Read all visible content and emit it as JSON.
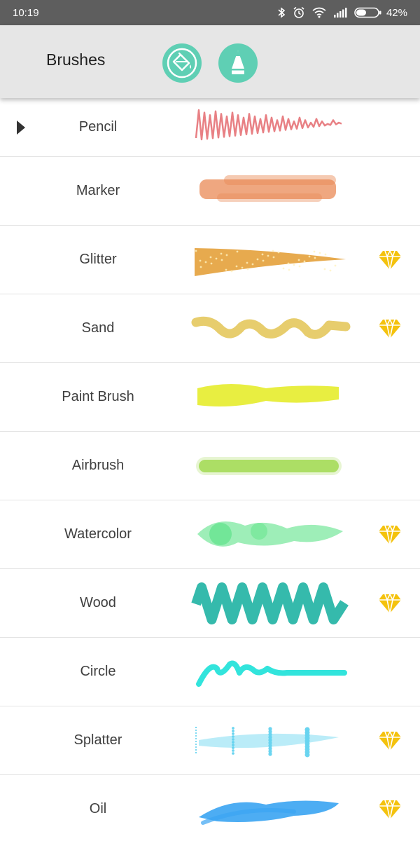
{
  "status_bar": {
    "time": "10:19",
    "battery": "42%",
    "icons": [
      "bluetooth-icon",
      "alarm-icon",
      "wifi-icon",
      "signal-icon",
      "battery-icon"
    ]
  },
  "toolbar": {
    "title": "Brushes",
    "buttons": [
      {
        "name": "paint-bucket-button",
        "icon": "paint-bucket-icon"
      },
      {
        "name": "pen-button",
        "icon": "pen-icon"
      }
    ],
    "accent_color": "#5fcfb4"
  },
  "brushes": [
    {
      "label": "Pencil",
      "color": "#e46a6e",
      "premium": false,
      "selected": true
    },
    {
      "label": "Marker",
      "color": "#e98a55",
      "premium": false,
      "selected": false
    },
    {
      "label": "Glitter",
      "color": "#e4a13b",
      "premium": true,
      "selected": false
    },
    {
      "label": "Sand",
      "color": "#e3c453",
      "premium": true,
      "selected": false
    },
    {
      "label": "Paint Brush",
      "color": "#e6ec2c",
      "premium": false,
      "selected": false
    },
    {
      "label": "Airbrush",
      "color": "#9ed84a",
      "premium": false,
      "selected": false
    },
    {
      "label": "Watercolor",
      "color": "#4fe07e",
      "premium": true,
      "selected": false
    },
    {
      "label": "Wood",
      "color": "#1fb3a3",
      "premium": true,
      "selected": false
    },
    {
      "label": "Circle",
      "color": "#32e4dc",
      "premium": false,
      "selected": false
    },
    {
      "label": "Splatter",
      "color": "#67d4f0",
      "premium": true,
      "selected": false
    },
    {
      "label": "Oil",
      "color": "#3aa4f2",
      "premium": true,
      "selected": false
    }
  ],
  "premium_icon": "diamond-icon",
  "premium_color": "#f4c20d"
}
